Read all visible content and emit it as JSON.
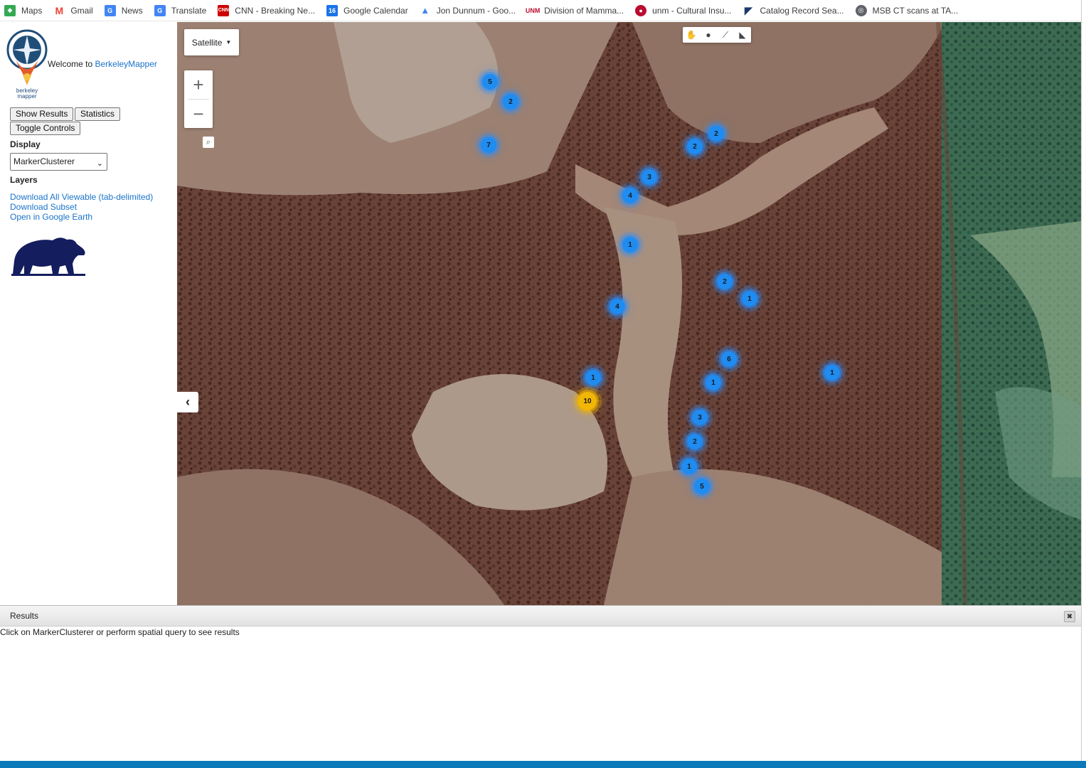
{
  "bookmarks": [
    {
      "label": "Maps",
      "icon": "maps-icon",
      "color": "#34a853"
    },
    {
      "label": "Gmail",
      "icon": "gmail-icon",
      "color": "#ea4335"
    },
    {
      "label": "News",
      "icon": "news-icon",
      "color": "#4285f4"
    },
    {
      "label": "Translate",
      "icon": "translate-icon",
      "color": "#4285f4"
    },
    {
      "label": "CNN - Breaking Ne...",
      "icon": "cnn-icon",
      "color": "#cc0000"
    },
    {
      "label": "Google Calendar",
      "icon": "calendar-icon",
      "color": "#1a73e8"
    },
    {
      "label": "Jon Dunnum - Goo...",
      "icon": "drive-icon",
      "color": "#4285f4"
    },
    {
      "label": "Division of Mamma...",
      "icon": "unm-icon",
      "color": "#ba0c2f"
    },
    {
      "label": "unm - Cultural Insu...",
      "icon": "unm-red-icon",
      "color": "#ba0c2f"
    },
    {
      "label": "Catalog Record Sea...",
      "icon": "catalog-icon",
      "color": "#1b3a6b"
    },
    {
      "label": "MSB CT scans at TA...",
      "icon": "globe-icon",
      "color": "#5f6368"
    }
  ],
  "sidebar": {
    "welcome_prefix": "Welcome to",
    "welcome_link": "BerkeleyMapper",
    "logo_text_1": "berkeley",
    "logo_text_2": "mapper",
    "buttons": {
      "show_results": "Show Results",
      "statistics": "Statistics",
      "toggle_controls": "Toggle Controls"
    },
    "display_label": "Display",
    "display_value": "MarkerClusterer",
    "layers_label": "Layers",
    "links": {
      "download_all": "Download All Viewable (tab-delimited)",
      "download_subset": "Download Subset",
      "google_earth": "Open in Google Earth"
    }
  },
  "map": {
    "map_type": "Satellite",
    "clusters": [
      {
        "count": "5",
        "color": "blue"
      },
      {
        "count": "2",
        "color": "blue"
      },
      {
        "count": "7",
        "color": "blue"
      },
      {
        "count": "2",
        "color": "blue"
      },
      {
        "count": "2",
        "color": "blue"
      },
      {
        "count": "3",
        "color": "blue"
      },
      {
        "count": "4",
        "color": "blue"
      },
      {
        "count": "1",
        "color": "blue"
      },
      {
        "count": "2",
        "color": "blue"
      },
      {
        "count": "1",
        "color": "blue"
      },
      {
        "count": "4",
        "color": "blue"
      },
      {
        "count": "6",
        "color": "blue"
      },
      {
        "count": "1",
        "color": "blue"
      },
      {
        "count": "1",
        "color": "blue"
      },
      {
        "count": "1",
        "color": "blue"
      },
      {
        "count": "10",
        "color": "gold"
      },
      {
        "count": "3",
        "color": "blue"
      },
      {
        "count": "2",
        "color": "blue"
      },
      {
        "count": "1",
        "color": "blue"
      },
      {
        "count": "5",
        "color": "blue"
      }
    ]
  },
  "results": {
    "title": "Results",
    "message": "Click on MarkerClusterer or perform spatial query to see results"
  }
}
